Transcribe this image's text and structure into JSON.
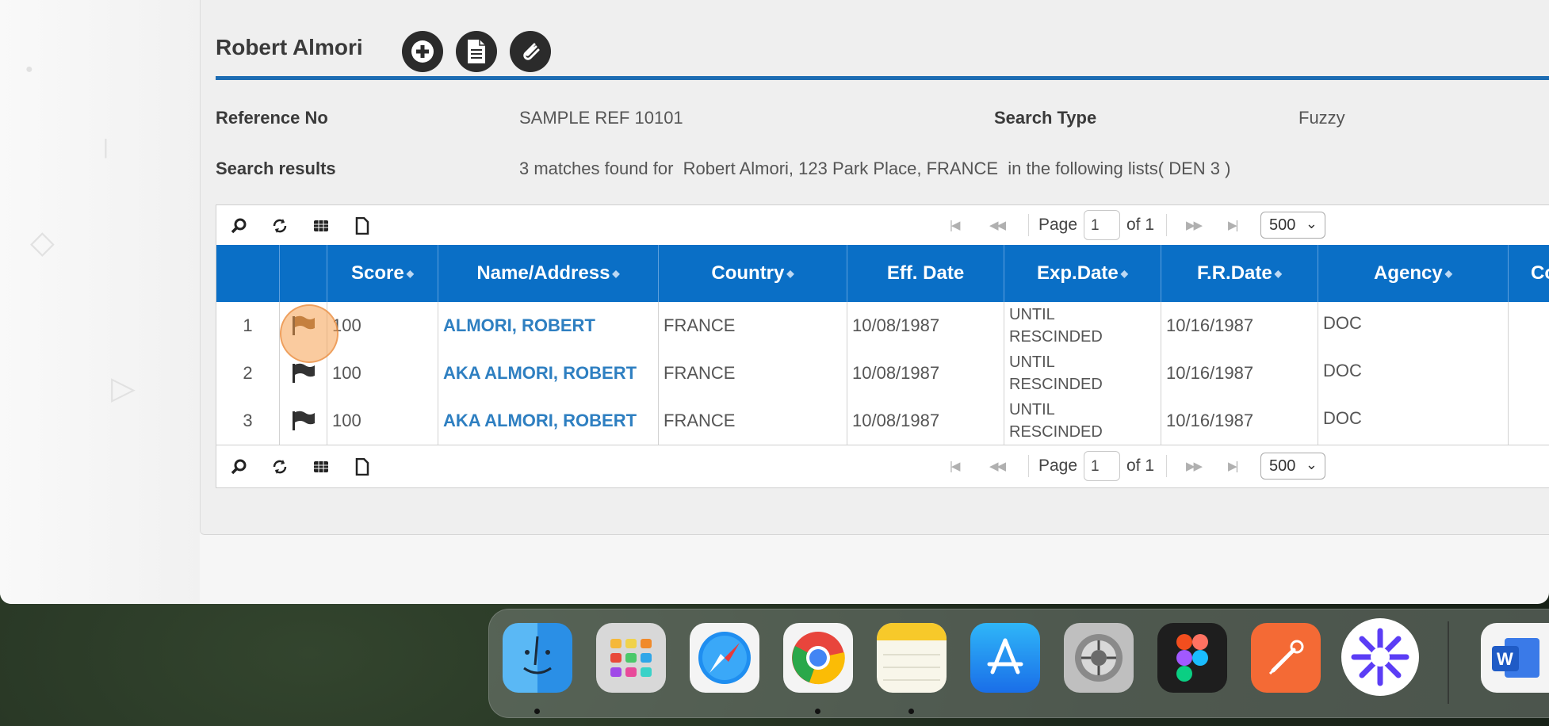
{
  "header": {
    "title": "Robert Almori"
  },
  "info": {
    "reference_label": "Reference No",
    "reference_value": "SAMPLE REF 10101",
    "search_type_label": "Search Type",
    "search_type_value": "Fuzzy",
    "results_label": "Search results",
    "results_value": "3 matches found for  Robert Almori, 123 Park Place, FRANCE  in the following lists( DEN 3 )"
  },
  "pager": {
    "page_label": "Page",
    "page_value": "1",
    "of_label": "of 1",
    "page_size": "500"
  },
  "columns": [
    "Score",
    "Name/Address",
    "Country",
    "Eff. Date",
    "Exp.Date",
    "F.R.Date",
    "Agency",
    "Co"
  ],
  "rows": [
    {
      "num": "1",
      "score": "100",
      "name": "ALMORI, ROBERT",
      "country": "FRANCE",
      "eff": "10/08/1987",
      "exp1": "UNTIL",
      "exp2": "RESCINDED",
      "fr": "10/16/1987",
      "agency": "DOC",
      "flag_color": "#8a5a2a"
    },
    {
      "num": "2",
      "score": "100",
      "name": "AKA ALMORI, ROBERT",
      "country": "FRANCE",
      "eff": "10/08/1987",
      "exp1": "UNTIL",
      "exp2": "RESCINDED",
      "fr": "10/16/1987",
      "agency": "DOC",
      "flag_color": "#333333"
    },
    {
      "num": "3",
      "score": "100",
      "name": "AKA ALMORI, ROBERT",
      "country": "FRANCE",
      "eff": "10/08/1987",
      "exp1": "UNTIL",
      "exp2": "RESCINDED",
      "fr": "10/16/1987",
      "agency": "DOC",
      "flag_color": "#333333"
    }
  ],
  "colors": {
    "accent": "#1d6cb3",
    "header_bg": "#0a6fc6",
    "link": "#2e7fc1"
  },
  "dock": {
    "apps": [
      "finder-icon",
      "launchpad-icon",
      "safari-icon",
      "chrome-icon",
      "notes-icon",
      "app-store-icon",
      "system-settings-icon",
      "figma-icon",
      "postman-icon",
      "perplexity-icon",
      "word-icon"
    ]
  }
}
